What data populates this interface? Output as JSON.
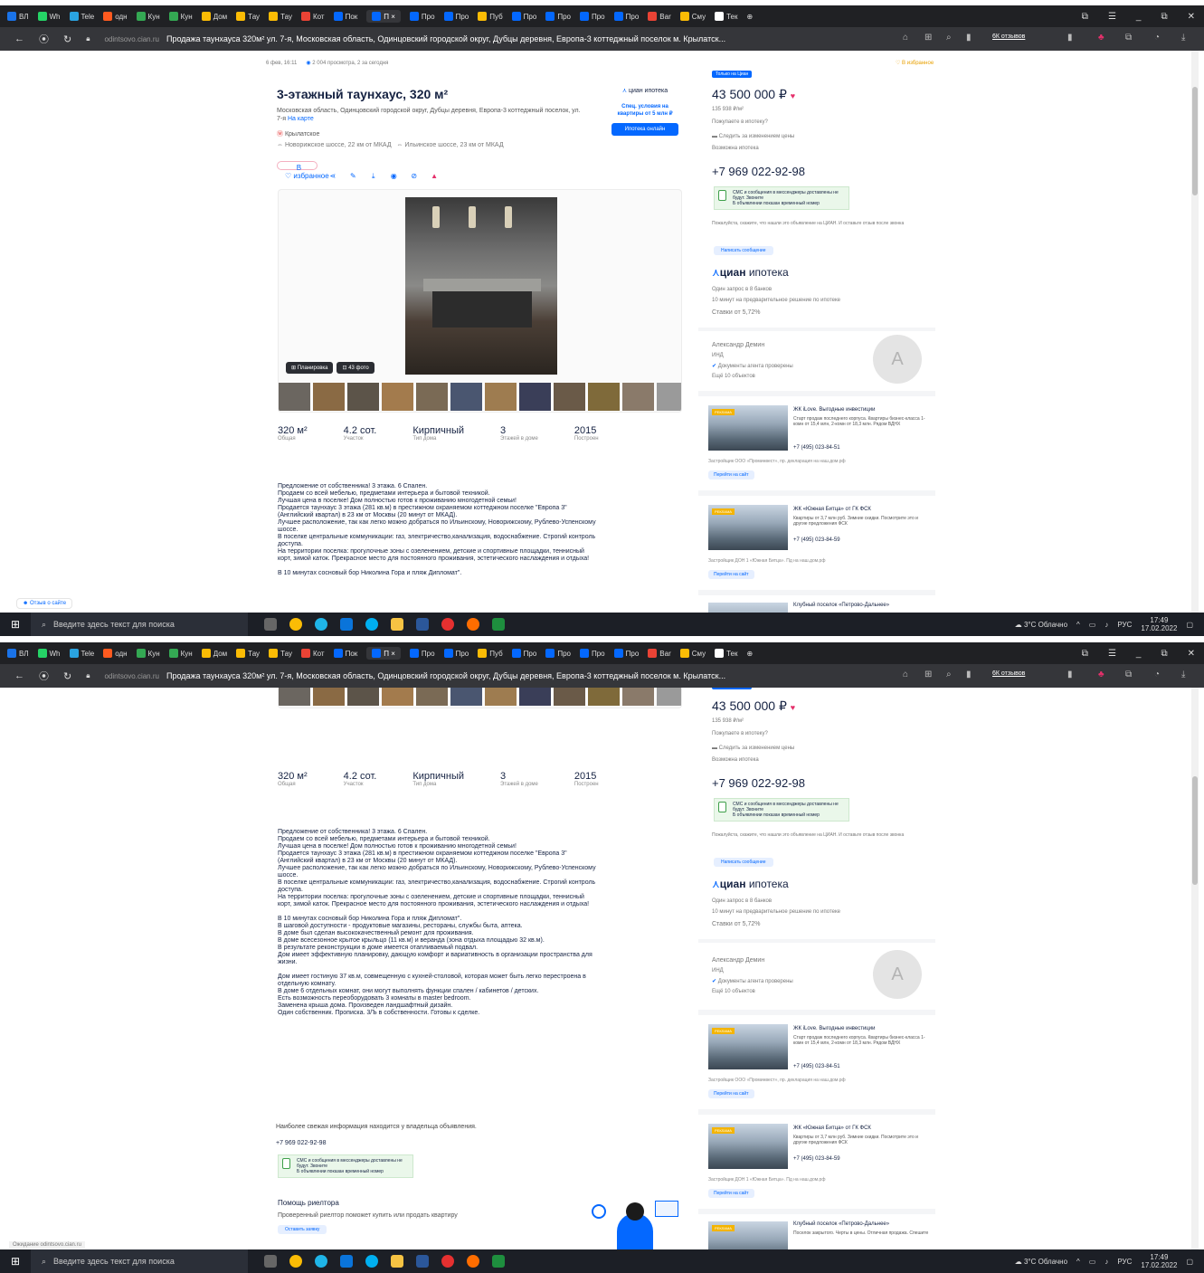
{
  "browser": {
    "tabs": [
      "Wh",
      "Tele",
      "Кун",
      "Кун",
      "Дом",
      "Тау",
      "Тау",
      "Кот",
      "Пок",
      "П",
      "Про",
      "Про",
      "Пуб",
      "Про",
      "Про",
      "Про",
      "Про",
      "Bar",
      "Сму",
      "Тек"
    ],
    "active_tab": "П ×",
    "url": "odintsovo.cian.ru",
    "page_title": "Продажа таунхауса 320м² ул. 7-я, Московская область, Одинцовский городской округ, Дубцы деревня, Европа-3 коттеджный поселок м. Крылатск...",
    "reviews_link": "6К отзывов"
  },
  "taskbar": {
    "search_placeholder": "Введите здесь текст для поиска",
    "weather": "3°C Облачно",
    "lang": "РУС",
    "time": "17:49",
    "date": "17.02.2022"
  },
  "listing": {
    "meta_date": "6 фев, 16:11",
    "meta_views": "2 004 просмотра, 2 за сегодня",
    "favorites_top": "В избранное",
    "title": "3-этажный таунхаус, 320 м²",
    "address": "Московская область, Одинцовский городской округ, Дубцы деревня, Европа-3 коттеджный поселок, ул. 7-я",
    "map_link": "На карте",
    "metro": "Крылатское",
    "highway1": "Новорижское шоссе, 22 км от МКАД",
    "highway2": "Ильинское шоссе, 23 км от МКАД",
    "fav_button": "В избранное",
    "cian_ipoteka_small": "циан ипотека",
    "spec_offer": "Спец. условия на квартиры от 5 млн ₽",
    "ipoteka_btn": "Ипотека онлайн",
    "plan_badge": "Планировка",
    "photos_badge": "43 фото",
    "stats": [
      {
        "v": "320 м²",
        "l": "Общая"
      },
      {
        "v": "4.2 сот.",
        "l": "Участок"
      },
      {
        "v": "Кирпичный",
        "l": "Тип дома"
      },
      {
        "v": "3",
        "l": "Этажей в доме"
      },
      {
        "v": "2015",
        "l": "Построен"
      }
    ],
    "description_1": [
      "Предложение от собственника! 3 этажа. 6 Спален.",
      "Продаем со всей мебелью, предметами интерьера и бытовой техникой.",
      "Лучшая цена в поселке! Дом полностью готов к проживанию многодетной семьи!",
      "Продается таунхаус 3 этажа (281 кв.м) в престижном охраняемом коттеджном поселке \"Европа 3\"",
      "(Английский квартал) в 23 км от Москвы (20 минут от МКАД).",
      "Лучшее расположение, так как легко можно добраться по Ильинскому, Новорижскому, Рублево-Успенскому",
      "шоссе.",
      "В поселке центральные коммуникации: газ, электричество,канализация, водоснабжение. Строгий контроль",
      "доступа.",
      "На территории поселка: прогулочные зоны с озеленением, детские и спортивные площадки, теннисный",
      "корт, зимой каток. Прекрасное место для постоянного проживания, эстетического наслаждения и отдыха!"
    ],
    "description_2": [
      "В 10 минутах сосновый бор Николина Гора и пляж Дипломат\".",
      "В шаговой доступности - продуктовые магазины, рестораны, службы быта, аптека.",
      "В доме был сделан высококачественный ремонт для проживания.",
      "В доме всесезонное крытое крыльцо (11 кв.м) и веранда (зона отдыха площадью 32 кв.м).",
      "В результате реконструкции в доме имеется отапливаемый подвал.",
      "Дом имеет эффективную планировку, дающую комфорт и вариативность в организации пространства для",
      "жизни."
    ],
    "description_3": [
      "Дом имеет гостиную 37 кв.м, совмещенную с кухней-столовой, которая может быть легко перестроена в",
      "отдельную комнату.",
      "В доме 6 отдельных комнат, они могут выполнять функции спален / кабинетов / детских.",
      "Есть возможность переоборудовать 3 комнаты в master bedroom.",
      "Заменена крыша дома. Произведен ландшафтный дизайн.",
      "Один собственник. Прописка. 3/Ъ в собственности. Готовы к сделке."
    ],
    "owner_info": "Наиболее свежая информация находится у владельца объявления.",
    "owner_phone": "+7 969 022-92-98",
    "realtor_title": "Помощь риелтора",
    "realtor_text": "Проверенный риелтор поможет купить или продать квартиру",
    "realtor_btn": "Оставить заявку",
    "feedback": "Отзыв о сайте"
  },
  "sidebar": {
    "tag": "Только на Циан",
    "price": "43 500 000 ₽",
    "price_m2": "135 938 ₽/м²",
    "ipoteka_q": "Пожупаете в ипотеку?",
    "watch_price": "Следить за изменением цены",
    "ipoteka_possible": "Возможна ипотека",
    "phone": "+7 969 022-92-98",
    "sms": "СМС и сообщения в мессенджеры доставлены не будут. Звоните",
    "sms2": "Б объявлении показан временный номер",
    "note": "Пожалуйста, скажите, что нашли это объявление на ЦИАН. И оставьте отзыв после звонка",
    "write_btn": "Написать сообщение",
    "cian_ipoteka": "циан",
    "cian_ipoteka2": "ипотека",
    "ipoteka_line1": "Один запрос в 8 банков",
    "ipoteka_line2": "10 минут на предварительное решение по ипотеке",
    "ipoteka_rate": "Ставки от 5,72%",
    "agent_name": "Александр Демин",
    "agent_role": "ИНД",
    "agent_docs": "Документы агента проверены",
    "agent_more": "Ещё 10 объектов",
    "agent_initial": "А",
    "ads": [
      {
        "title": "ЖК iLove. Выгодные инвестиции",
        "text": "Старт продаж последнего корпуса. Квартиры бизнес-класса 1-комн от 15,4 млн, 2-комн от 18,3 млн. Рядом ВДНХ",
        "phone": "+7 (495) 023-84-51",
        "src": "Застройщик ООО «Проминвест», пр. декларация на наш.дом.рф",
        "btn": "Перейти на сайт"
      },
      {
        "title": "ЖК «Южная Битца» от ГК ФСК",
        "text": "Квартиры от 3,7 млн руб. Зимние скидки. Посмотрите это и другие предложения ФСК",
        "phone": "+7 (495) 023-84-59",
        "src": "Застройщик ДОН 1 «Южная Битца». Пд на наш.дом.рф",
        "btn": "Перейти на сайт"
      },
      {
        "title": "Клубный поселок «Петрово-Дальнее»",
        "text": "Поселок закрытого. Черты в цены. Отличная продажа. Спешите",
        "phone": "",
        "src": "",
        "btn": ""
      }
    ]
  },
  "status_url": "Ожидание odintsovo.cian.ru"
}
